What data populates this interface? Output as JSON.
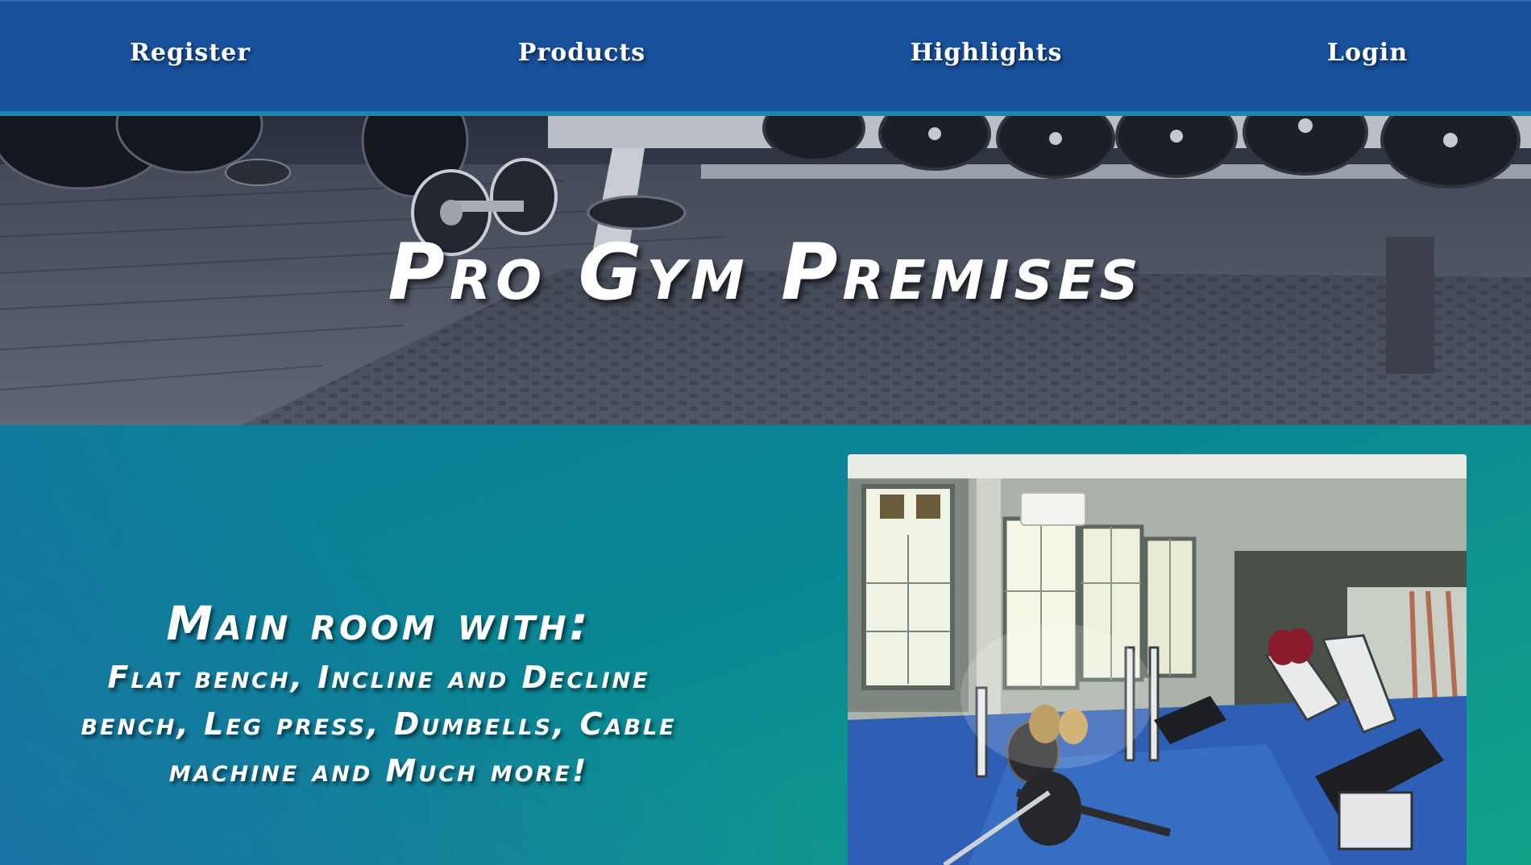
{
  "nav": {
    "items": [
      {
        "label": "Register"
      },
      {
        "label": "Products"
      },
      {
        "label": "Highlights"
      },
      {
        "label": "Login"
      }
    ]
  },
  "hero": {
    "title": "Pro Gym Premises"
  },
  "feature": {
    "heading": "Main room with:",
    "description": "Flat bench, Incline and Decline bench, Leg press, Dumbells, Cable machine and Much more!"
  },
  "colors": {
    "nav_background": "#18509b",
    "nav_accent": "#1b87b0",
    "section_gradient_start": "#0e7d9a",
    "section_gradient_end": "#12a28a",
    "text": "#ffffff"
  }
}
